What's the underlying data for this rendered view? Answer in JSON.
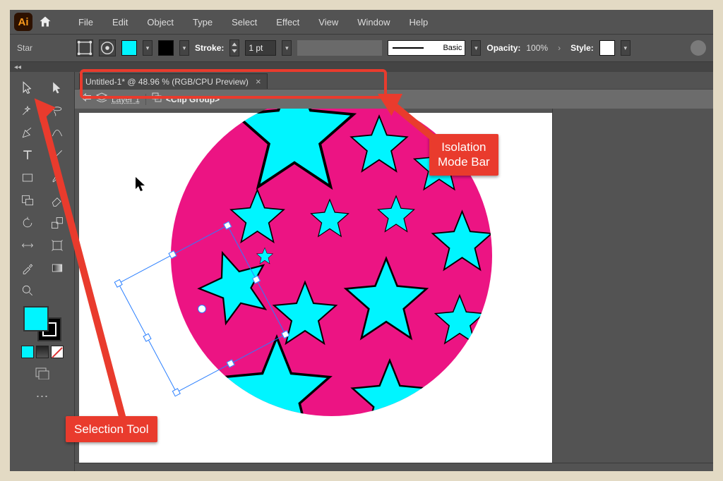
{
  "menu": {
    "items": [
      "File",
      "Edit",
      "Object",
      "Type",
      "Select",
      "Effect",
      "View",
      "Window",
      "Help"
    ]
  },
  "options": {
    "tool_label": "Star",
    "stroke_label": "Stroke:",
    "stroke_value": "1 pt",
    "brush_label": "Basic",
    "opacity_label": "Opacity:",
    "opacity_value": "100%",
    "style_label": "Style:"
  },
  "document": {
    "tab_title": "Untitled-1* @ 48.96 % (RGB/CPU Preview)"
  },
  "isolation": {
    "layer_label": "Layer 1",
    "clip_label": "<Clip Group>"
  },
  "callouts": {
    "selection_tool": "Selection Tool",
    "isolation_bar_l1": "Isolation",
    "isolation_bar_l2": "Mode Bar"
  },
  "colors": {
    "fill": "#00f5ff",
    "magenta": "#ec1483",
    "callout": "#e93b2d",
    "selection_blue": "#2a7fff"
  }
}
